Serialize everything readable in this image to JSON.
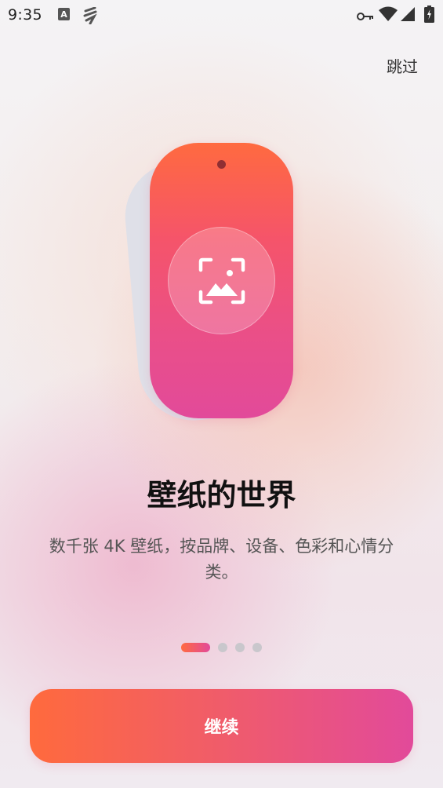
{
  "status_bar": {
    "time": "9:35",
    "icons": [
      "text-a-icon",
      "flash-icon",
      "vpn-key-icon",
      "wifi-icon",
      "signal-icon",
      "battery-icon"
    ]
  },
  "header": {
    "skip_label": "跳过"
  },
  "onboarding": {
    "title": "壁纸的世界",
    "description": "数千张 4K 壁纸，按品牌、设备、色彩和心情分类。",
    "illustration_icon": "wallpaper-photo-icon",
    "page_indicator": {
      "total": 4,
      "current": 1
    }
  },
  "footer": {
    "continue_label": "继续"
  },
  "colors": {
    "accent_start": "#ff6a40",
    "accent_end": "#e24a9a",
    "title_text": "#111111",
    "body_text": "#555555"
  }
}
